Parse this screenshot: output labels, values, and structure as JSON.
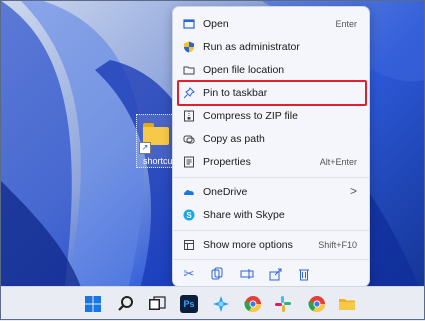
{
  "desktop": {
    "shortcut_label": "shortcu"
  },
  "context_menu": {
    "items": [
      {
        "label": "Open",
        "shortcut": "Enter",
        "icon": "open-icon"
      },
      {
        "label": "Run as administrator",
        "icon": "shield-icon"
      },
      {
        "label": "Open file location",
        "icon": "folder-icon"
      },
      {
        "label": "Pin to taskbar",
        "icon": "pin-icon",
        "highlighted": true
      },
      {
        "label": "Compress to ZIP file",
        "icon": "zip-icon"
      },
      {
        "label": "Copy as path",
        "icon": "copy-path-icon"
      },
      {
        "label": "Properties",
        "shortcut": "Alt+Enter",
        "icon": "properties-icon"
      },
      {
        "label": "OneDrive",
        "icon": "onedrive-icon",
        "submenu": ">"
      },
      {
        "label": "Share with Skype",
        "icon": "skype-icon"
      },
      {
        "label": "Show more options",
        "shortcut": "Shift+F10",
        "icon": "more-options-icon"
      }
    ],
    "toolbar_icons": [
      "cut-icon",
      "copy-icon",
      "rename-icon",
      "share-icon",
      "delete-icon"
    ],
    "highlight_color": "#e0202a"
  },
  "taskbar": {
    "icons": [
      "start-icon",
      "search-icon",
      "task-view-icon",
      "photoshop-icon",
      "app-icon",
      "chrome-icon",
      "slack-icon",
      "chrome-icon",
      "file-explorer-icon"
    ],
    "photoshop_label": "Ps"
  }
}
